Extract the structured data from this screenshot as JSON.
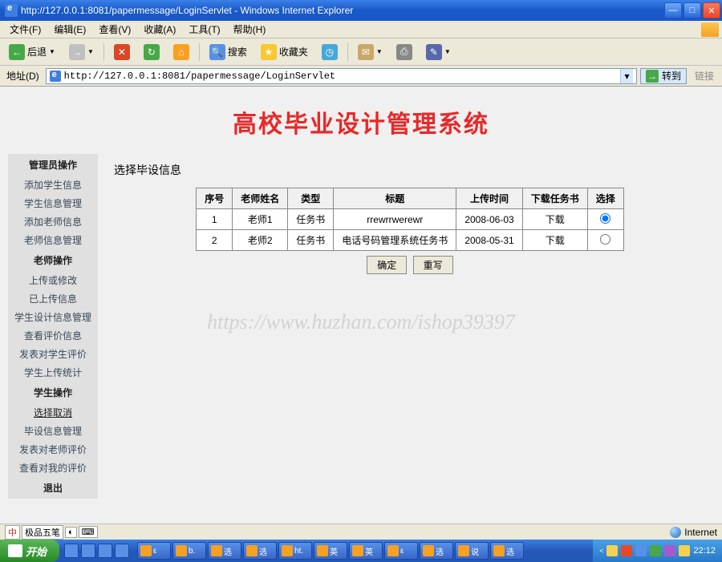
{
  "window_title": "http://127.0.0.1:8081/papermessage/LoginServlet - Windows Internet Explorer",
  "menu": [
    "文件(F)",
    "编辑(E)",
    "查看(V)",
    "收藏(A)",
    "工具(T)",
    "帮助(H)"
  ],
  "toolbar": {
    "back": "后退",
    "search": "搜索",
    "favorites": "收藏夹"
  },
  "address": {
    "label": "地址(D)",
    "url": "http://127.0.0.1:8081/papermessage/LoginServlet",
    "go_label": "转到",
    "links_label": "链接"
  },
  "app_title": "高校毕业设计管理系统",
  "section_heading": "选择毕设信息",
  "sidebar": [
    {
      "head": "管理员操作",
      "items": [
        "添加学生信息",
        "学生信息管理",
        "添加老师信息",
        "老师信息管理"
      ]
    },
    {
      "head": "老师操作",
      "items": [
        "上传或修改",
        "已上传信息",
        "学生设计信息管理",
        "查看评价信息",
        "发表对学生评价",
        "学生上传统计"
      ]
    },
    {
      "head": "学生操作",
      "items": [
        "选择取消",
        "毕设信息管理",
        "发表对老师评价",
        "查看对我的评价"
      ]
    },
    {
      "head": "退出",
      "items": []
    }
  ],
  "active_item": "选择取消",
  "table": {
    "headers": [
      "序号",
      "老师姓名",
      "类型",
      "标题",
      "上传时间",
      "下载任务书",
      "选择"
    ],
    "rows": [
      {
        "no": "1",
        "teacher": "老师1",
        "type": "任务书",
        "title": "rrewrrwerewr",
        "date": "2008-06-03",
        "download": "下载",
        "selected": true
      },
      {
        "no": "2",
        "teacher": "老师2",
        "type": "任务书",
        "title": "电话号码管理系统任务书",
        "date": "2008-05-31",
        "download": "下载",
        "selected": false
      }
    ]
  },
  "buttons": {
    "ok": "确定",
    "reset": "重写"
  },
  "watermark": "https://www.huzhan.com/ishop39397",
  "status": {
    "ime": "极品五笔",
    "zone": "Internet"
  },
  "taskbar": {
    "start": "开始",
    "tasks": [
      "ε",
      "b.",
      "选",
      "选",
      "ht.",
      "英",
      "英",
      "ε",
      "选",
      "说",
      "选"
    ],
    "clock": "22:12"
  }
}
